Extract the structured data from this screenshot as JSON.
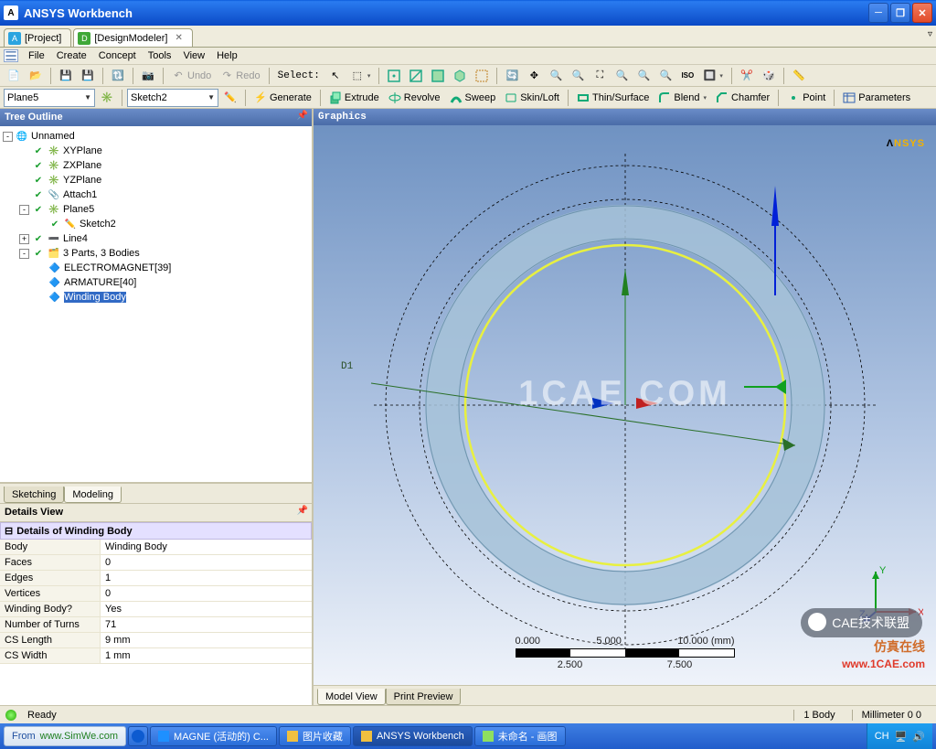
{
  "titlebar": {
    "title": "ANSYS Workbench"
  },
  "doc_tabs": [
    {
      "label": "[Project]",
      "icon_color": "#2BA4E0",
      "icon_text": "A",
      "active": false,
      "closable": false
    },
    {
      "label": "[DesignModeler]",
      "icon_color": "#3FA838",
      "icon_text": "DM",
      "active": true,
      "closable": true
    }
  ],
  "menu": [
    "File",
    "Create",
    "Concept",
    "Tools",
    "View",
    "Help"
  ],
  "toolbar1": {
    "undo": "Undo",
    "redo": "Redo",
    "select": "Select:"
  },
  "toolbar2": {
    "plane_dd": "Plane5",
    "sketch_dd": "Sketch2",
    "generate": "Generate",
    "extrude": "Extrude",
    "revolve": "Revolve",
    "sweep": "Sweep",
    "skinloft": "Skin/Loft",
    "thinsurface": "Thin/Surface",
    "blend": "Blend",
    "chamfer": "Chamfer",
    "point": "Point",
    "parameters": "Parameters"
  },
  "tree_title": "Tree Outline",
  "tree": [
    {
      "indent": 0,
      "exp": "-",
      "icon": "globe",
      "color": "#308EE0",
      "label": "Unnamed"
    },
    {
      "indent": 1,
      "exp": "",
      "icon": "plane",
      "checked": true,
      "label": "XYPlane"
    },
    {
      "indent": 1,
      "exp": "",
      "icon": "plane",
      "checked": true,
      "label": "ZXPlane"
    },
    {
      "indent": 1,
      "exp": "",
      "icon": "plane",
      "checked": true,
      "label": "YZPlane"
    },
    {
      "indent": 1,
      "exp": "",
      "icon": "attach",
      "checked": true,
      "label": "Attach1"
    },
    {
      "indent": 1,
      "exp": "-",
      "icon": "plane",
      "checked": true,
      "label": "Plane5"
    },
    {
      "indent": 2,
      "exp": "",
      "icon": "sketch",
      "checked": true,
      "label": "Sketch2"
    },
    {
      "indent": 1,
      "exp": "+",
      "icon": "line",
      "checked": true,
      "label": "Line4"
    },
    {
      "indent": 1,
      "exp": "-",
      "icon": "parts",
      "checked": true,
      "label": "3 Parts, 3 Bodies"
    },
    {
      "indent": 2,
      "exp": "",
      "icon": "body",
      "label": "ELECTROMAGNET[39]"
    },
    {
      "indent": 2,
      "exp": "",
      "icon": "body",
      "label": "ARMATURE[40]"
    },
    {
      "indent": 2,
      "exp": "",
      "icon": "body",
      "label": "Winding Body",
      "selected": true
    }
  ],
  "bottom_tabs": {
    "sketching": "Sketching",
    "modeling": "Modeling"
  },
  "details_title": "Details View",
  "details_group": "Details of Winding Body",
  "details": [
    {
      "k": "Body",
      "v": "Winding Body"
    },
    {
      "k": "Faces",
      "v": "0"
    },
    {
      "k": "Edges",
      "v": "1"
    },
    {
      "k": "Vertices",
      "v": "0"
    },
    {
      "k": "Winding Body?",
      "v": "Yes"
    },
    {
      "k": "Number of Turns",
      "v": "71"
    },
    {
      "k": "CS Length",
      "v": "9 mm"
    },
    {
      "k": "CS Width",
      "v": "1 mm"
    }
  ],
  "graphics_title": "Graphics",
  "d1_label": "D1",
  "scalebar": {
    "ticks_top": [
      "0.000",
      "5.000",
      "10.000 (mm)"
    ],
    "ticks_bottom": [
      "2.500",
      "7.500"
    ]
  },
  "viewport_tabs": {
    "model_view": "Model View",
    "print_preview": "Print Preview"
  },
  "status": {
    "ready": "Ready",
    "body_count": "1 Body",
    "units": "Millimeter 0 0"
  },
  "taskbar": {
    "from_label": "From",
    "from_url": "www.SimWe.com",
    "items": [
      {
        "label": "MAGNE (活动的) C...",
        "icon": "#1E90FF"
      },
      {
        "label": "图片收藏",
        "icon": "#F0C040"
      },
      {
        "label": "ANSYS Workbench",
        "icon": "#F0C040",
        "active": true
      },
      {
        "label": "未命名 - 画图",
        "icon": "#8EE060"
      }
    ],
    "tray": {
      "lang": "CH"
    }
  },
  "watermarks": {
    "center": "1CAE COM",
    "bubble": "CAE技术联盟",
    "line1": "仿真在线",
    "line2": "www.1CAE.com"
  },
  "triad_labels": {
    "x": "X",
    "y": "Y",
    "z": "Z"
  }
}
